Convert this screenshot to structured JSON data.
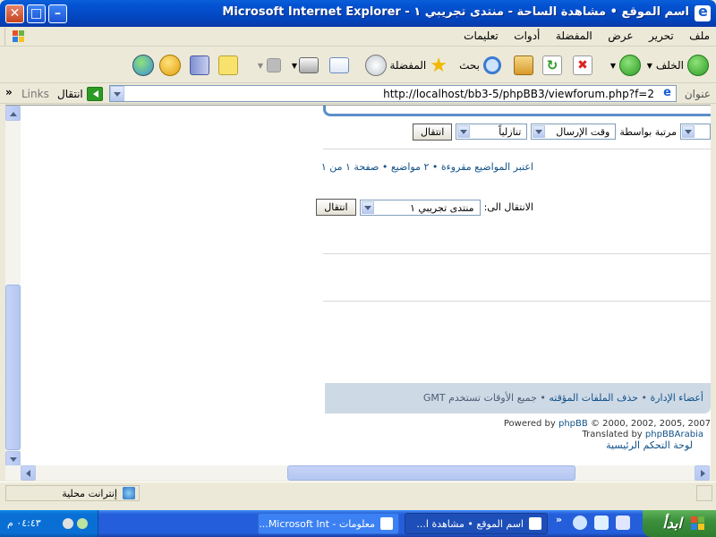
{
  "window": {
    "title": "اسم الموقع • مشاهدة الساحة - منتدى تجريبي ١ - Microsoft Internet Explorer",
    "close_label": "✕",
    "max_label": "□",
    "min_label": "–"
  },
  "menu": [
    "ملف",
    "تحرير",
    "عرض",
    "المفضلة",
    "أدوات",
    "تعليمات"
  ],
  "toolbar": {
    "back_label": "الخلف",
    "search_label": "بحث",
    "favorites_label": "المفضلة"
  },
  "address": {
    "label": "عنوان",
    "url": "http://localhost/bb3-5/phpBB3/viewforum.php?f=2",
    "go_label": "انتقال",
    "links_label": "Links",
    "chevron": "»"
  },
  "page": {
    "sort_by_label": "مرتبة بواسطة",
    "sort_key": "وقت الإرسال",
    "sort_dir": "تنازلياً",
    "go_button": "انتقال",
    "topic_info": {
      "mark_read": "اعتبر المواضيع مقروءة",
      "sep": " • ",
      "count": "٢ مواضيع",
      "pages": "صفحة ١ من ١"
    },
    "jump_label": "الانتقال الى:",
    "jump_value": "منتدى تجريبي ١",
    "jump_button": "انتقال",
    "footer_links": {
      "team": "أعضاء الإدارة",
      "delete_cookies": "حذف الملفات المؤقته",
      "sep": " • ",
      "timezone": "جميع الأوقات تستخدم GMT"
    },
    "powered_prefix": "Powered by ",
    "phpbb": "phpBB",
    "copyright": " © 2000, 2002, 2005, 2007",
    "translated_prefix": "Translated by ",
    "phpbbarabia": "phpBBArabia",
    "cp_link": "لوحة التحكم الرئيسية"
  },
  "status": {
    "zone": "إنترانت محلية"
  },
  "taskbar": {
    "start_label": "ابدأ",
    "task1": "اسم الموقع • مشاهدة ا...",
    "task2": "معلومات - Microsoft Int...",
    "clock": "٠٤:٤٣ م",
    "quick_chevron": "»"
  },
  "colors": {
    "titlebar": "#0453d3",
    "link": "#105289",
    "footer_bg": "#ced9e6"
  }
}
